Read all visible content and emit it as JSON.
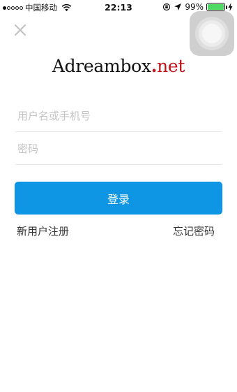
{
  "status_bar": {
    "carrier": "中国移动",
    "time": "22:13",
    "battery": "99%",
    "battery_level": 0.99,
    "signal_bars_filled": 1,
    "signal_bars_total": 5,
    "icons": [
      "wifi-icon",
      "rotation-lock-icon",
      "location-arrow-icon",
      "battery-icon",
      "charging-bolt-icon"
    ]
  },
  "logo": {
    "main": "Adreambox",
    "dot": ".",
    "suffix": "net"
  },
  "form": {
    "username_placeholder": "用户名或手机号",
    "password_placeholder": "密码",
    "login_label": "登录"
  },
  "links": {
    "register": "新用户注册",
    "forgot": "忘记密码"
  },
  "colors": {
    "primary": "#0e95e4",
    "logo_accent": "#c0121b",
    "battery": "#4cd964"
  }
}
